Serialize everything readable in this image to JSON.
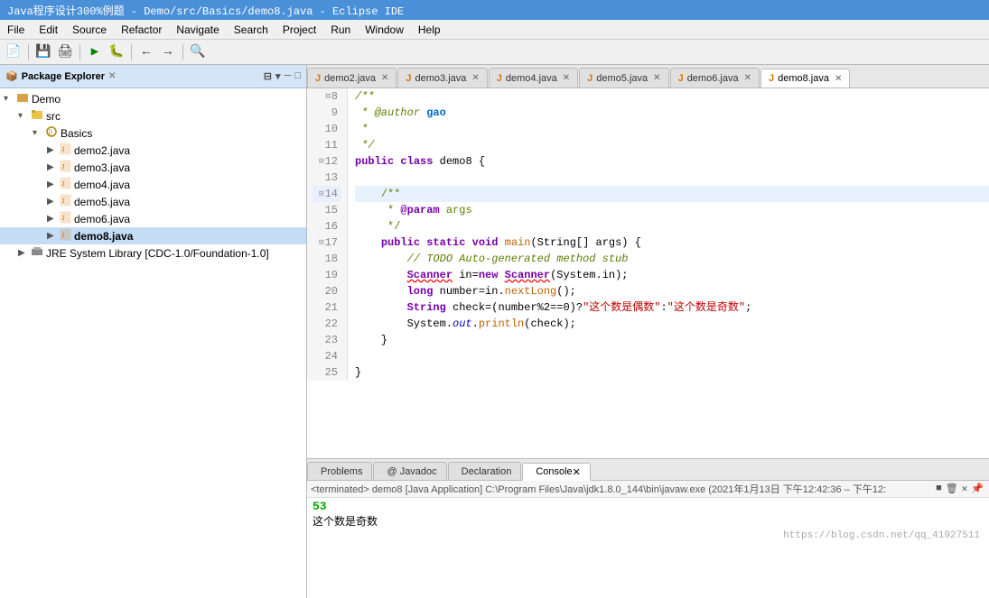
{
  "title": "Java程序设计300%例题 - Demo/src/Basics/demo8.java - Eclipse IDE",
  "menubar": {
    "items": [
      "File",
      "Edit",
      "Source",
      "Refactor",
      "Navigate",
      "Search",
      "Project",
      "Run",
      "Window",
      "Help"
    ]
  },
  "left_panel": {
    "title": "Package Explorer",
    "tree": [
      {
        "level": 0,
        "arrow": "▾",
        "icon": "📁",
        "label": "Demo",
        "type": "project"
      },
      {
        "level": 1,
        "arrow": "▾",
        "icon": "📁",
        "label": "src",
        "type": "folder"
      },
      {
        "level": 2,
        "arrow": "▾",
        "icon": "📦",
        "label": "Basics",
        "type": "package"
      },
      {
        "level": 3,
        "arrow": "▶",
        "icon": "📄",
        "label": "demo2.java",
        "type": "file"
      },
      {
        "level": 3,
        "arrow": "▶",
        "icon": "📄",
        "label": "demo3.java",
        "type": "file"
      },
      {
        "level": 3,
        "arrow": "▶",
        "icon": "📄",
        "label": "demo4.java",
        "type": "file"
      },
      {
        "level": 3,
        "arrow": "▶",
        "icon": "📄",
        "label": "demo5.java",
        "type": "file"
      },
      {
        "level": 3,
        "arrow": "▶",
        "icon": "📄",
        "label": "demo6.java",
        "type": "file"
      },
      {
        "level": 3,
        "arrow": "▶",
        "icon": "📄",
        "label": "demo8.java",
        "type": "file",
        "selected": true
      },
      {
        "level": 1,
        "arrow": "▶",
        "icon": "📚",
        "label": "JRE System Library [CDC-1.0/Foundation-1.0]",
        "type": "lib"
      }
    ]
  },
  "editor": {
    "tabs": [
      {
        "label": "demo2.java",
        "active": false,
        "closable": true
      },
      {
        "label": "demo3.java",
        "active": false,
        "closable": true
      },
      {
        "label": "demo4.java",
        "active": false,
        "closable": true
      },
      {
        "label": "demo5.java",
        "active": false,
        "closable": true
      },
      {
        "label": "demo6.java",
        "active": false,
        "closable": true
      },
      {
        "label": "demo8.java",
        "active": true,
        "closable": true
      }
    ],
    "lines": [
      {
        "num": 8,
        "content": "/**",
        "type": "comment"
      },
      {
        "num": 9,
        "content": " * @author gao",
        "type": "comment"
      },
      {
        "num": 10,
        "content": " *",
        "type": "comment"
      },
      {
        "num": 11,
        "content": " */",
        "type": "comment"
      },
      {
        "num": 12,
        "content": "public class demo8 {",
        "type": "code"
      },
      {
        "num": 13,
        "content": "",
        "type": "code"
      },
      {
        "num": 14,
        "content": "    /**",
        "type": "comment",
        "highlighted": true
      },
      {
        "num": 15,
        "content": "     * @param args",
        "type": "comment"
      },
      {
        "num": 16,
        "content": "     */",
        "type": "comment"
      },
      {
        "num": 17,
        "content": "    public static void main(String[] args) {",
        "type": "code"
      },
      {
        "num": 18,
        "content": "        // TODO Auto-generated method stub",
        "type": "comment"
      },
      {
        "num": 19,
        "content": "        Scanner in=new Scanner(System.in);",
        "type": "code",
        "error": true
      },
      {
        "num": 20,
        "content": "        long number=in.nextLong();",
        "type": "code"
      },
      {
        "num": 21,
        "content": "        String check=(number%2==0)?\"这个数是偶数\":\"这个数是奇数\";",
        "type": "code"
      },
      {
        "num": 22,
        "content": "        System.out.println(check);",
        "type": "code"
      },
      {
        "num": 23,
        "content": "    }",
        "type": "code"
      },
      {
        "num": 24,
        "content": "",
        "type": "code"
      },
      {
        "num": 25,
        "content": "}",
        "type": "code"
      }
    ]
  },
  "bottom_panel": {
    "tabs": [
      {
        "label": "Problems",
        "icon": "⚠",
        "active": false
      },
      {
        "label": "@ Javadoc",
        "icon": "",
        "active": false
      },
      {
        "label": "Declaration",
        "icon": "📋",
        "active": false
      },
      {
        "label": "Console",
        "icon": "▶",
        "active": true,
        "closable": false
      }
    ],
    "console": {
      "status": "<terminated> demo8 [Java Application] C:\\Program Files\\Java\\jdk1.8.0_144\\bin\\javaw.exe (2021年1月13日 下午12:42:36 – 下午12:",
      "output_line1": "53",
      "output_line2": "这个数是奇数",
      "watermark": "https://blog.csdn.net/qq_41927511"
    }
  }
}
